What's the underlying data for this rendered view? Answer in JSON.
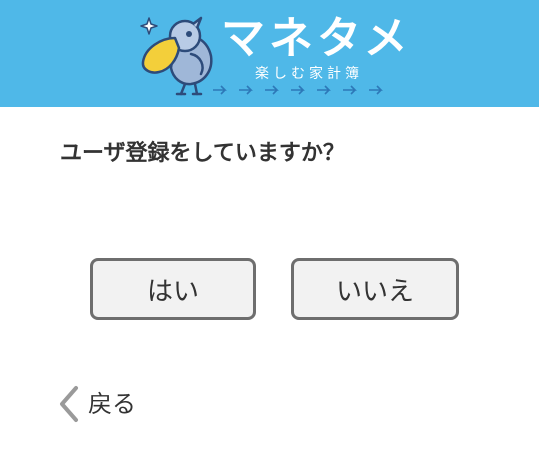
{
  "header": {
    "background_color": "#4fb8e8",
    "logo": {
      "title": "マネタメ",
      "subtitle": "楽しむ家計簿",
      "icon": "shoebill-bird-mascot"
    }
  },
  "main": {
    "question": "ユーザ登録をしていますか？",
    "buttons": {
      "yes_label": "はい",
      "no_label": "いいえ"
    }
  },
  "footer": {
    "back_label": "戻る",
    "back_icon": "chevron-left-icon"
  }
}
